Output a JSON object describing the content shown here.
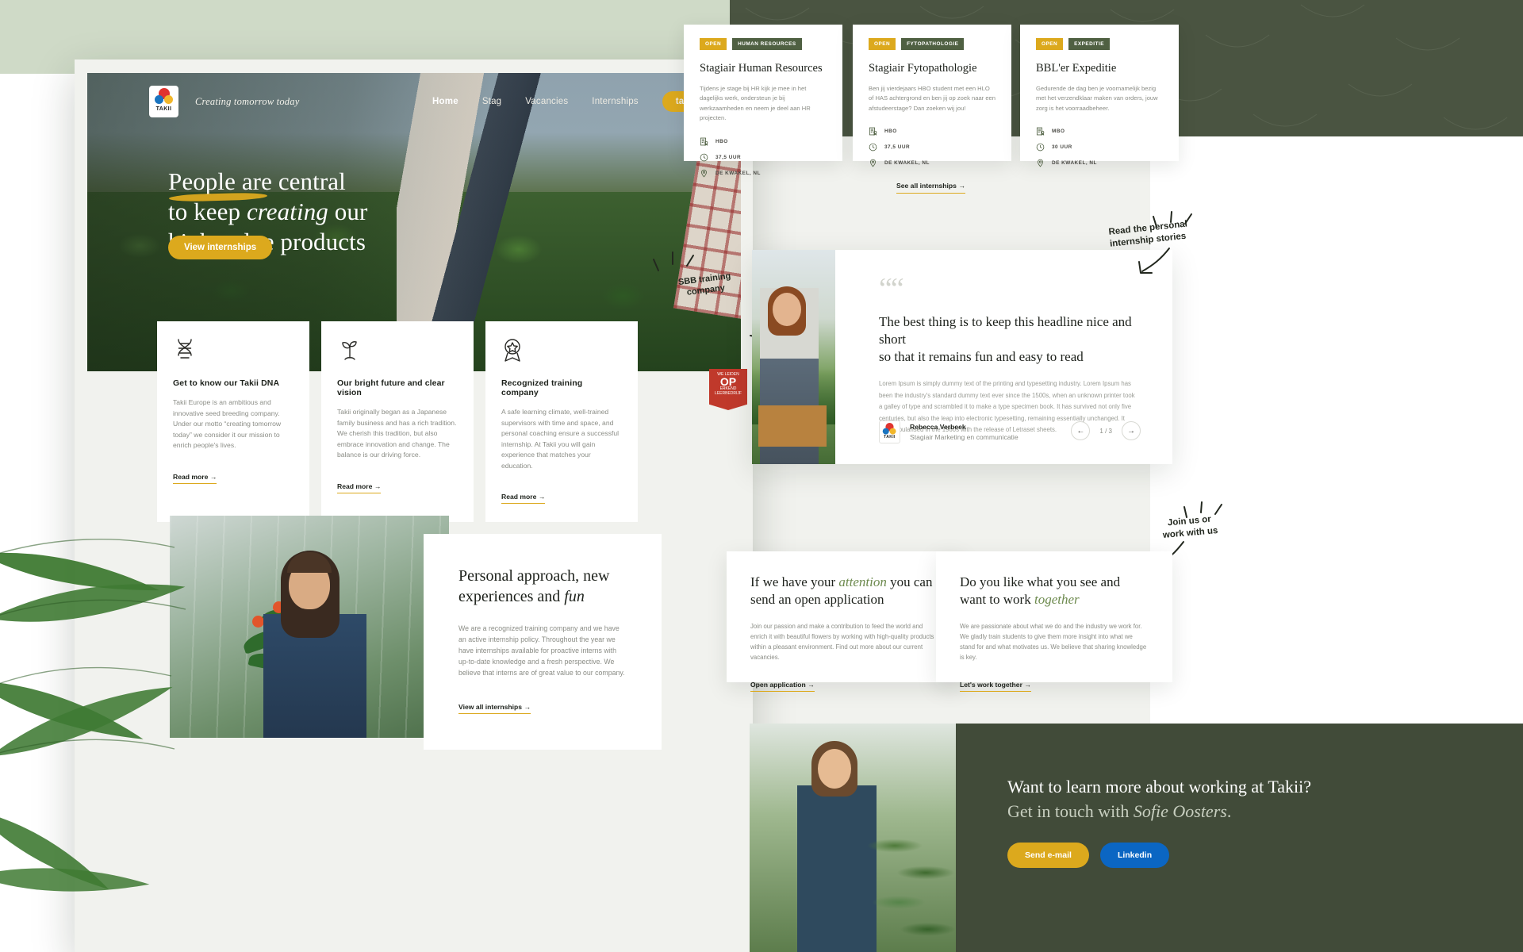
{
  "brand": {
    "logo_word": "TAKII",
    "tagline": "Creating tomorrow today",
    "accent_gold": "#dca91d",
    "accent_green": "#4f6042",
    "dark_green": "#414b39",
    "sage": "#cfdac7"
  },
  "nav": {
    "items": [
      {
        "label": "Home",
        "active": true
      },
      {
        "label": "Stag",
        "active": false
      },
      {
        "label": "Vacancies",
        "active": false
      },
      {
        "label": "Internships",
        "active": false
      }
    ],
    "cta_label": "takii.eu"
  },
  "hero": {
    "line1": "People are central",
    "line2_pre": "to keep ",
    "line2_em": "creating",
    "line2_post": " our",
    "line3": "high-value products",
    "cta_label": "View internships"
  },
  "feature_cards": [
    {
      "icon": "dna-icon",
      "title": "Get to know our Takii DNA",
      "body": "Takii Europe is an ambitious and innovative seed breeding company. Under our motto “creating tomorrow today” we consider it our mission to enrich people's lives.",
      "link": "Read more →"
    },
    {
      "icon": "sprout-icon",
      "title": "Our bright future and clear vision",
      "body": "Takii originally began as a Japanese family business and has a rich tradition. We cherish this tradition, but also embrace innovation and change. The balance is our driving force.",
      "link": "Read more →"
    },
    {
      "icon": "award-icon",
      "title": "Recognized training company",
      "body": "A safe learning climate, well-trained supervisors with time and space, and personal coaching ensure a successful internship. At Takii you will gain experience that matches your education.",
      "link": "Read more →"
    }
  ],
  "sbb_note": {
    "line1": "SBB training",
    "line2": "company",
    "badge_top": "WE LEIDEN",
    "badge_big": "OP",
    "badge_bottom": "ERKEND LEERBEDRIJF"
  },
  "personal_approach": {
    "title_line1": "Personal approach, new",
    "title_line2_pre": "experiences and ",
    "title_line2_em": "fun",
    "body": "We are a recognized training company and we have an active internship policy. Throughout the year we have internships available for proactive interns with up-to-date knowledge and a fresh perspective. We believe that interns are of great value to our company.",
    "link": "View all internships →"
  },
  "jobs": {
    "cards": [
      {
        "tag_status": "OPEN",
        "tag_dept": "HUMAN RESOURCES",
        "title": "Stagiair Human Resources",
        "body": "Tijdens je stage bij HR kijk je mee in het dagelijks werk, ondersteun je bij werkzaamheden en neem je deel aan HR projecten.",
        "meta": [
          {
            "icon": "diploma-icon",
            "label": "HBO"
          },
          {
            "icon": "clock-icon",
            "label": "37,5 UUR"
          },
          {
            "icon": "pin-icon",
            "label": "DE KWAKEL, NL"
          }
        ]
      },
      {
        "tag_status": "OPEN",
        "tag_dept": "FYTOPATHOLOGIE",
        "title": "Stagiair Fytopathologie",
        "body": "Ben jij vierdejaars HBO student met een HLO of HAS achtergrond en ben jij op zoek naar een afstudeerstage? Dan zoeken wij jou!",
        "meta": [
          {
            "icon": "diploma-icon",
            "label": "HBO"
          },
          {
            "icon": "clock-icon",
            "label": "37,5 UUR"
          },
          {
            "icon": "pin-icon",
            "label": "DE KWAKEL, NL"
          }
        ]
      },
      {
        "tag_status": "OPEN",
        "tag_dept": "EXPEDITIE",
        "title": "BBL'er Expeditie",
        "body": "Gedurende de dag ben je voornamelijk bezig met het verzendklaar maken van orders, jouw zorg is het voorraadbeheer.",
        "meta": [
          {
            "icon": "diploma-icon",
            "label": "MBO"
          },
          {
            "icon": "clock-icon",
            "label": "30 UUR"
          },
          {
            "icon": "pin-icon",
            "label": "DE KWAKEL, NL"
          }
        ]
      }
    ],
    "see_all_label": "See all internships →"
  },
  "testimonial": {
    "quote_mark": "“",
    "headline_line1": "The best thing is to keep this headline nice and short",
    "headline_line2": "so that it remains fun and easy to read",
    "body": "Lorem Ipsum is simply dummy text of the printing and typesetting industry. Lorem Ipsum has been the industry's standard dummy text ever since the 1500s, when an unknown printer took a galley of type and scrambled it to make a type specimen book. It has survived not only five centuries, but also the leap into electronic typesetting, remaining essentially unchanged. It was popularised in the 1960s with the release of Letraset sheets.",
    "author_name": "Rebecca Verbeek",
    "author_role": "Stagiair Marketing en communicatie",
    "pager": "1 / 3",
    "prev_icon": "←",
    "next_icon": "→"
  },
  "notes": {
    "stories_line1": "Read the personal",
    "stories_line2": "internship stories",
    "join_line1": "Join us or",
    "join_line2": "work with us"
  },
  "cta_cards": [
    {
      "title_pre": "If we have your ",
      "title_em": "attention",
      "title_post": " you can",
      "title_line2": "send an open application",
      "body": "Join our passion and make a contribution to feed the world and enrich it with beautiful flowers by working with high-quality products within a pleasant environment. Find out more about our current vacancies.",
      "link": "Open application →"
    },
    {
      "title_pre": "Do you like what you see and",
      "title_line2_pre": "want to work ",
      "title_line2_em": "together",
      "body": "We are passionate about what we do and the industry we work for. We gladly train students to give them more insight into what we stand for and what motivates us. We believe that sharing knowledge is key.",
      "link": "Let's work together →"
    }
  ],
  "footer": {
    "line1": "Want to learn more about working at Takii?",
    "line2_pre": "Get in touch with ",
    "line2_em": "Sofie Oosters",
    "line2_post": ".",
    "btn_email": "Send e-mail",
    "btn_linkedin": "Linkedin"
  }
}
